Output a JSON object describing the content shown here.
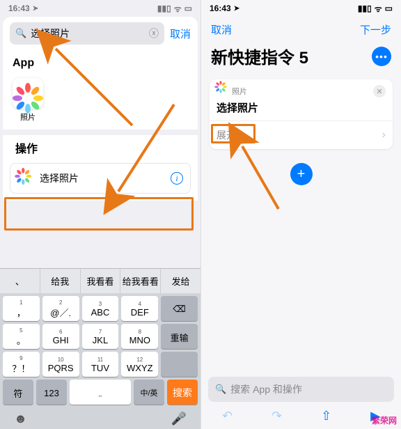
{
  "status": {
    "time": "16:43",
    "location_icon": "loc-arrow"
  },
  "left": {
    "search_value": "选择照片",
    "cancel": "取消",
    "section_app": "App",
    "app_photos_label": "照片",
    "section_actions": "操作",
    "action_select_photo": "选择照片",
    "suggestions": [
      "、",
      "给我",
      "我看看",
      "给我看看",
      "发给"
    ],
    "keys": {
      "r1": [
        [
          "1",
          "，"
        ],
        [
          "2",
          "@／."
        ],
        [
          "3",
          "ABC"
        ],
        [
          "4",
          "DEF"
        ]
      ],
      "r2": [
        [
          "5",
          "。"
        ],
        [
          "6",
          "GHI"
        ],
        [
          "7",
          "JKL"
        ],
        [
          "8",
          "MNO"
        ]
      ],
      "r3": [
        [
          "9",
          "？！"
        ],
        [
          "10",
          "PQRS"
        ],
        [
          "11",
          "TUV"
        ],
        [
          "12",
          "WXYZ"
        ]
      ],
      "bksp": "⌫",
      "reinput": "重输",
      "sym": "符",
      "num": "123",
      "space": "空格",
      "lang": "中/英",
      "search": "搜索"
    }
  },
  "right": {
    "nav_cancel": "取消",
    "nav_next": "下一步",
    "title": "新快捷指令 5",
    "card_app": "照片",
    "card_title": "选择照片",
    "card_expand": "展开",
    "search_placeholder": "搜索 App 和操作"
  },
  "brand": "繁荣网"
}
